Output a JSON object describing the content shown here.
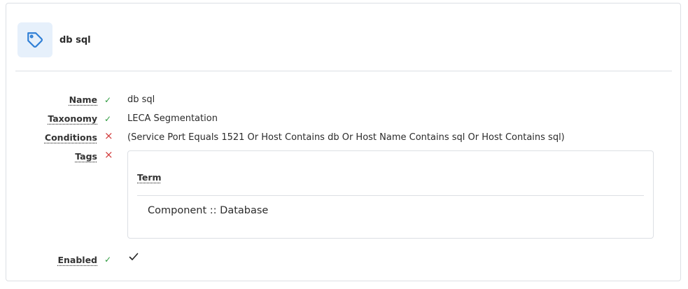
{
  "header": {
    "title": "db sql",
    "icon": "tag-icon"
  },
  "fields": {
    "name": {
      "label": "Name",
      "value": "db sql",
      "status": "ok"
    },
    "taxonomy": {
      "label": "Taxonomy",
      "value": "LECA Segmentation",
      "status": "ok"
    },
    "conditions": {
      "label": "Conditions",
      "value": "(Service Port Equals 1521 Or Host Contains db Or Host Name Contains sql Or Host Contains sql)",
      "status": "error"
    },
    "tags": {
      "label": "Tags",
      "status": "error",
      "column_header": "Term",
      "rows": [
        "Component :: Database"
      ]
    },
    "enabled": {
      "label": "Enabled",
      "status": "ok",
      "value": true
    }
  },
  "colors": {
    "ok": "#2e9b3f",
    "error": "#d23b3b",
    "accent": "#2f7fd6",
    "icon_bg": "#e6f0fb"
  },
  "symbols": {
    "ok": "✓",
    "error": "×"
  }
}
